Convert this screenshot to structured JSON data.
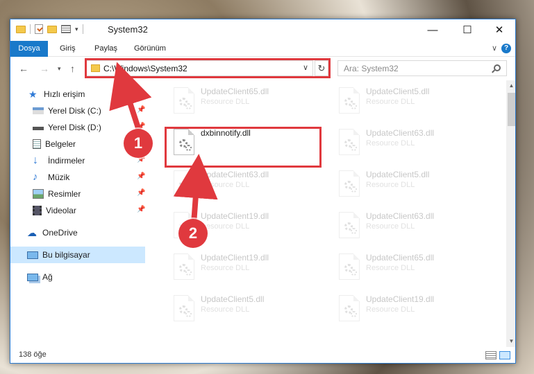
{
  "window": {
    "title": "System32",
    "minimize": "—",
    "maximize": "☐",
    "close": "✕"
  },
  "ribbon": {
    "tabs": [
      "Dosya",
      "Giriş",
      "Paylaş",
      "Görünüm"
    ],
    "help": "?"
  },
  "navigation": {
    "address": "C:\\Windows\\System32",
    "search_placeholder": "Ara: System32"
  },
  "sidebar": {
    "quick_access": "Hızlı erişim",
    "items": [
      {
        "label": "Yerel Disk (C:)",
        "icon": "drive-icon",
        "pinned": true
      },
      {
        "label": "Yerel Disk (D:)",
        "icon": "drive-icon",
        "pinned": true
      },
      {
        "label": "Belgeler",
        "icon": "documents-icon",
        "pinned": true
      },
      {
        "label": "İndirmeler",
        "icon": "download-icon",
        "pinned": true
      },
      {
        "label": "Müzik",
        "icon": "music-icon",
        "pinned": true
      },
      {
        "label": "Resimler",
        "icon": "pictures-icon",
        "pinned": true
      },
      {
        "label": "Videolar",
        "icon": "video-icon",
        "pinned": true
      }
    ],
    "onedrive": "OneDrive",
    "this_pc": "Bu bilgisayar",
    "network": "Ağ"
  },
  "files": [
    {
      "name": "UpdateClient65.dll",
      "type": "Resource DLL"
    },
    {
      "name": "UpdateClient5.dll",
      "type": "Resource DLL"
    },
    {
      "name": "dxbinnotify.dll",
      "type": ""
    },
    {
      "name": "UpdateClient63.dll",
      "type": "Resource DLL"
    },
    {
      "name": "UpdateClient63.dll",
      "type": "Resource DLL"
    },
    {
      "name": "UpdateClient5.dll",
      "type": "Resource DLL"
    },
    {
      "name": "UpdateClient19.dll",
      "type": "Resource DLL"
    },
    {
      "name": "UpdateClient63.dll",
      "type": "Resource DLL"
    },
    {
      "name": "UpdateClient19.dll",
      "type": "Resource DLL"
    },
    {
      "name": "UpdateClient65.dll",
      "type": "Resource DLL"
    },
    {
      "name": "UpdateClient5.dll",
      "type": "Resource DLL"
    },
    {
      "name": "UpdateClient19.dll",
      "type": "Resource DLL"
    }
  ],
  "status": {
    "count": "138 öğe"
  },
  "annotations": {
    "marker1": "1",
    "marker2": "2",
    "color": "#e0393e"
  }
}
